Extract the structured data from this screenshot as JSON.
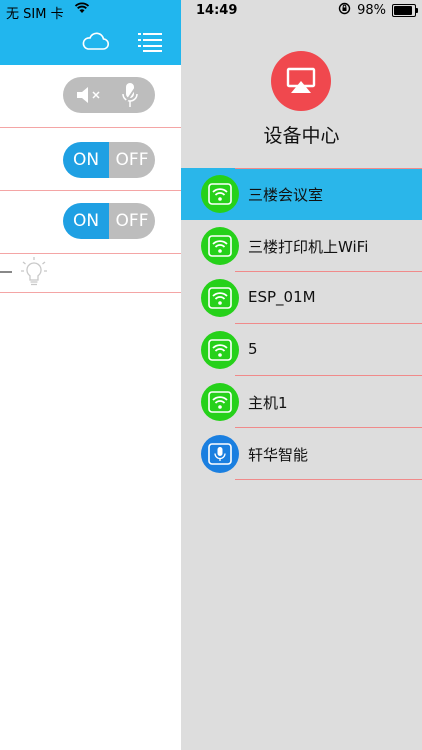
{
  "status_bar": {
    "carrier": "无 SIM 卡",
    "time": "14:49",
    "battery": "98%"
  },
  "left_panel": {
    "toggles": [
      {
        "on_label": "ON",
        "off_label": "OFF"
      },
      {
        "on_label": "ON",
        "off_label": "OFF"
      }
    ]
  },
  "device_center": {
    "title": "设备中心",
    "devices": [
      {
        "label": "三楼会议室",
        "icon": "wifi-icon",
        "selected": true
      },
      {
        "label": "三楼打印机上WiFi",
        "icon": "wifi-icon"
      },
      {
        "label": "ESP_01M",
        "icon": "wifi-icon"
      },
      {
        "label": "5",
        "icon": "wifi-icon"
      },
      {
        "label": "主机1",
        "icon": "wifi-icon"
      },
      {
        "label": "轩华智能",
        "icon": "microphone-icon"
      }
    ]
  },
  "colors": {
    "header_blue": "#21b6ee",
    "selected_blue": "#2ab6ea",
    "wifi_green": "#26d11a",
    "airplay_red": "#f0484e",
    "toggle_on": "#1fa0e3"
  }
}
